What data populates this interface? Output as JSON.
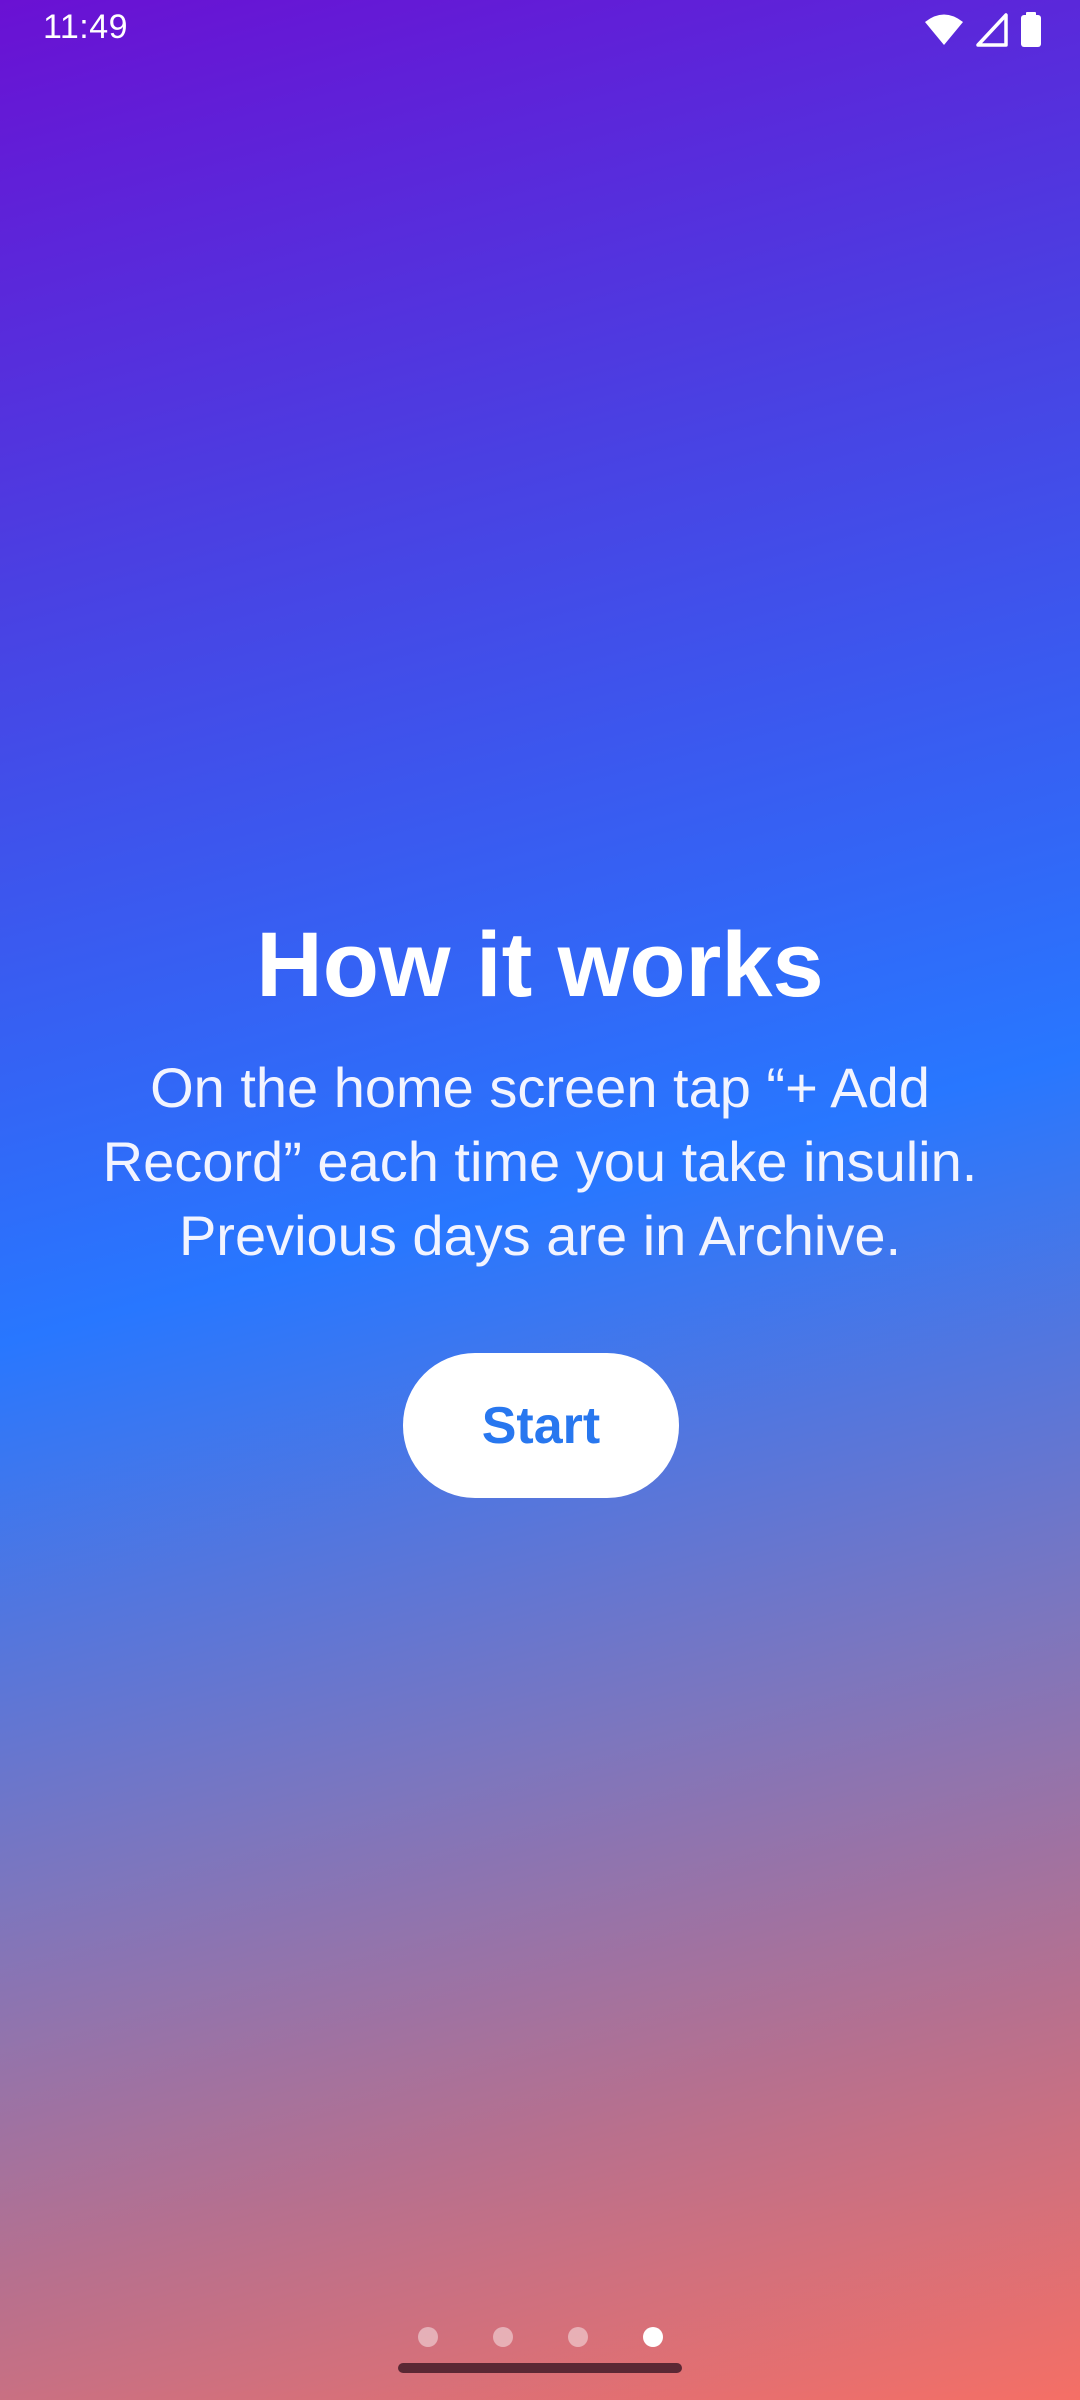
{
  "status_bar": {
    "time": "11:49",
    "icons": [
      "wifi-icon",
      "cellular-signal-icon",
      "battery-icon"
    ]
  },
  "onboarding": {
    "title": "How it works",
    "description_line1": "On the home screen tap “+ Add",
    "description_line2": "Record” each time you take insulin.",
    "description_line3": "Previous days are in Archive.",
    "start_label": "Start"
  },
  "pager": {
    "total_pages": 4,
    "active_page": 4
  },
  "colors": {
    "accent": "#2877ef",
    "gradient_top": "#6a11d3",
    "gradient_mid": "#2877ff",
    "gradient_bottom": "#f56f65"
  }
}
